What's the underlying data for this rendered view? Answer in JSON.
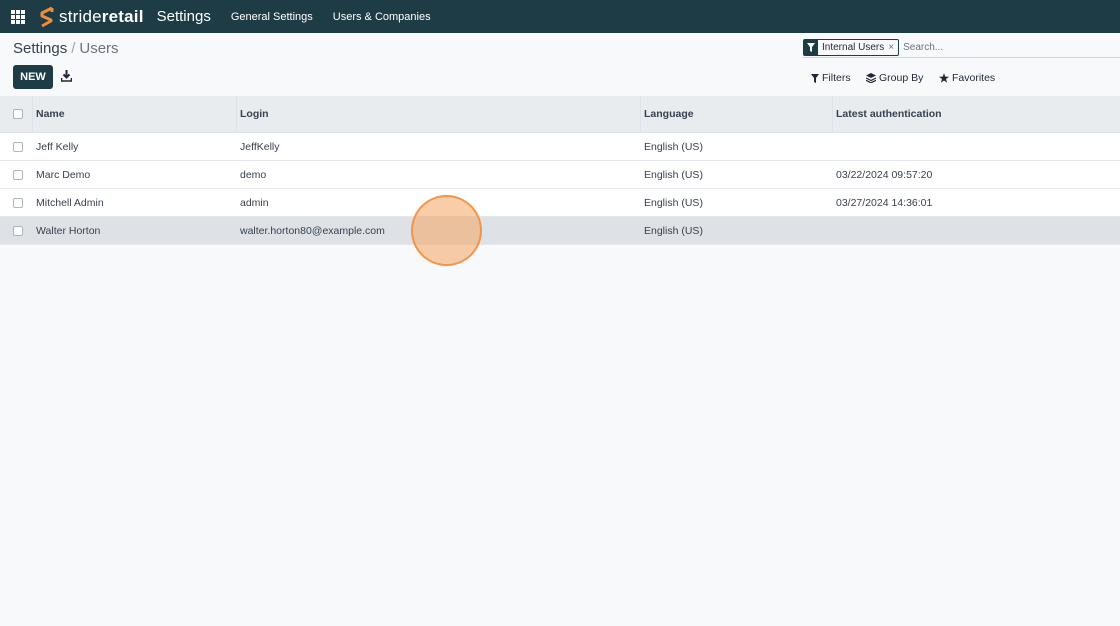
{
  "topbar": {
    "brand_a": "stride",
    "brand_b": "retail",
    "app_name": "Settings",
    "menu": [
      "General Settings",
      "Users & Companies"
    ],
    "icons": [
      "apps-grid-icon",
      "logo-mark-icon"
    ]
  },
  "breadcrumb": {
    "parent": "Settings",
    "separator": "/",
    "current": "Users"
  },
  "toolbar": {
    "new_label": "NEW",
    "download_icon": "download-icon"
  },
  "search": {
    "facet": "Internal Users",
    "facet_remove": "×",
    "placeholder": "Search..."
  },
  "controls": {
    "filters": "Filters",
    "group_by": "Group By",
    "favorites": "Favorites"
  },
  "table": {
    "headers": {
      "name": "Name",
      "login": "Login",
      "language": "Language",
      "auth": "Latest authentication"
    },
    "rows": [
      {
        "name": "Jeff Kelly",
        "login": "JeffKelly",
        "language": "English (US)",
        "auth": ""
      },
      {
        "name": "Marc Demo",
        "login": "demo",
        "language": "English (US)",
        "auth": "03/22/2024 09:57:20"
      },
      {
        "name": "Mitchell Admin",
        "login": "admin",
        "language": "English (US)",
        "auth": "03/27/2024 14:36:01"
      },
      {
        "name": "Walter Horton",
        "login": "walter.horton80@example.com",
        "language": "English (US)",
        "auth": ""
      }
    ]
  },
  "colors": {
    "brand": "#1e3c46",
    "accent": "#f08c3c",
    "highlight_row": "#dee2e6"
  }
}
